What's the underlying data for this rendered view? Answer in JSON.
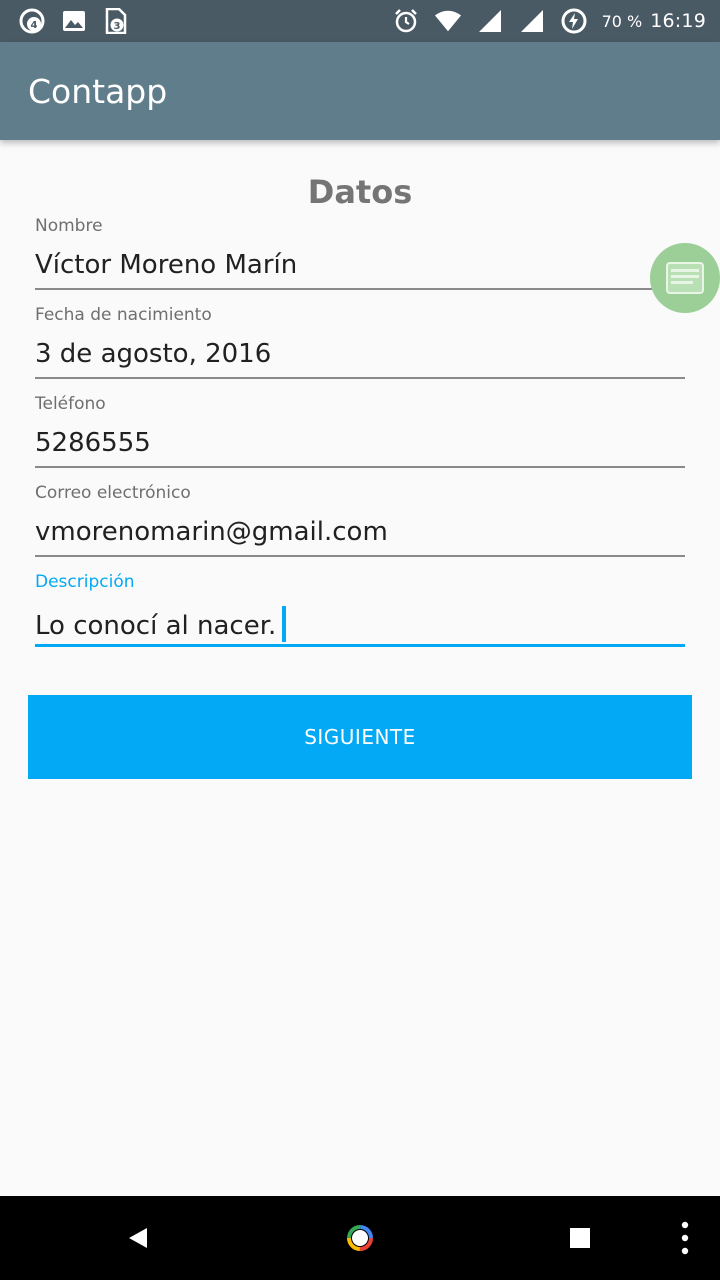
{
  "status_bar": {
    "left_icons": [
      "chrome-notification-icon",
      "gallery-notification-icon",
      "sim-notification-icon"
    ],
    "right_icons": [
      "alarm-icon",
      "wifi-icon",
      "signal-icon",
      "signal-icon-2",
      "battery-charging-icon"
    ],
    "battery": "70 %",
    "time": "16:19"
  },
  "app_bar": {
    "title": "Contapp"
  },
  "form": {
    "title": "Datos",
    "fields": [
      {
        "label": "Nombre",
        "value": "Víctor Moreno Marín"
      },
      {
        "label": "Fecha de nacimiento",
        "value": "3 de agosto, 2016"
      },
      {
        "label": "Teléfono",
        "value": "5286555"
      },
      {
        "label": "Correo electrónico",
        "value": "vmorenomarin@gmail.com"
      },
      {
        "label": "Descripción",
        "value": "Lo conocí al nacer."
      }
    ],
    "next_label": "SIGUIENTE"
  },
  "nav_bar": {
    "icons": [
      "back-icon",
      "home-icon",
      "recents-icon",
      "more-icon"
    ]
  },
  "colors": {
    "accent": "#03a9f4",
    "app_bar": "#607d8b",
    "status_bar": "#4a5a64",
    "bubble": "#9ccf98"
  }
}
